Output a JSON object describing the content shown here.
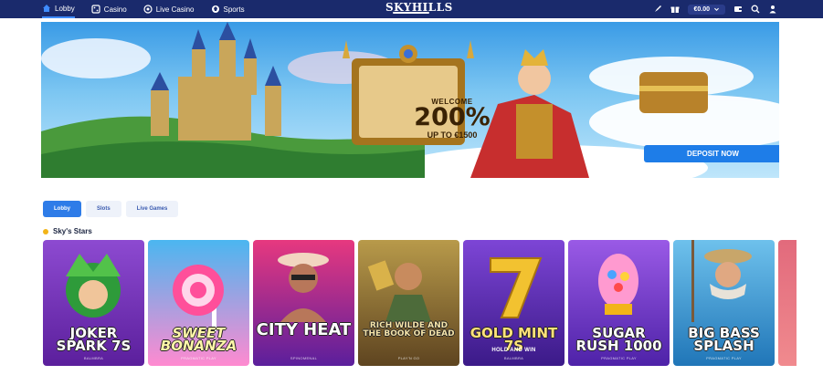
{
  "nav": {
    "items": [
      {
        "label": "Lobby",
        "icon": "home-icon",
        "active": true
      },
      {
        "label": "Casino",
        "icon": "dice-icon",
        "active": false
      },
      {
        "label": "Live Casino",
        "icon": "live-casino-icon",
        "active": false
      },
      {
        "label": "Sports",
        "icon": "sports-icon",
        "active": false
      }
    ],
    "logo": "SKYHILLS",
    "balance": "€0.00",
    "right_icons": [
      "rocket-icon",
      "gift-icon",
      "wallet-icon",
      "search-icon",
      "user-icon"
    ]
  },
  "hero": {
    "welcome": "WELCOME",
    "bonus": "200%",
    "bonus_sub": "UP TO €1500",
    "cta": "DEPOSIT NOW"
  },
  "tabs": [
    {
      "label": "Lobby",
      "active": true
    },
    {
      "label": "Slots",
      "active": false
    },
    {
      "label": "Live Games",
      "active": false
    }
  ],
  "section": {
    "title": "Sky's Stars"
  },
  "games": [
    {
      "title": "JOKER SPARK 7S",
      "provider": "BALMBRA",
      "bg": "#7a3db8"
    },
    {
      "title": "SWEET BONANZA",
      "provider": "PRAGMATIC PLAY",
      "bg": "#ff7ac0"
    },
    {
      "title": "CITY HEAT",
      "provider": "SPINOMENAL",
      "bg": "#c8317b"
    },
    {
      "title": "RICH WILDE AND THE BOOK OF DEAD",
      "provider": "PLAY'N GO",
      "bg": "#8a6a2a"
    },
    {
      "title": "GOLD MINT 7S",
      "subtitle": "HOLD AND WIN",
      "provider": "BALMBRA",
      "bg": "#5a2aa8"
    },
    {
      "title": "SUGAR RUSH 1000",
      "provider": "PRAGMATIC PLAY",
      "bg": "#6a3ec8"
    },
    {
      "title": "BIG BASS SPLASH",
      "provider": "PRAGMATIC PLAY",
      "bg": "#3b9bd6"
    }
  ]
}
